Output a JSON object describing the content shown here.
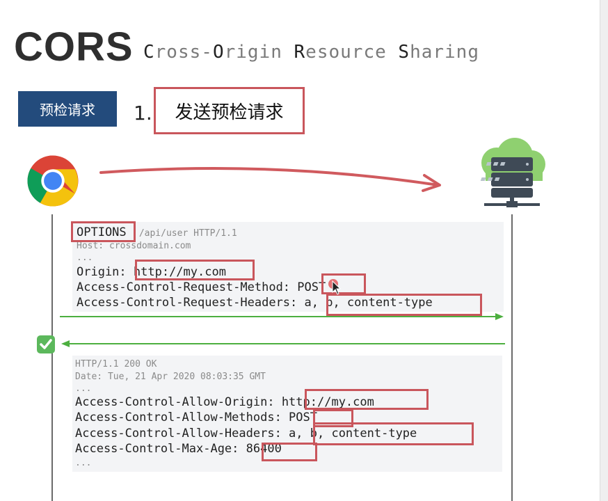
{
  "title": "CORS",
  "subtitle": {
    "c1": "C",
    "r1": "ross-",
    "c2": "O",
    "r2": "rigin ",
    "c3": "R",
    "r3": "esource ",
    "c4": "S",
    "r4": "haring"
  },
  "badge": "预检请求",
  "step": {
    "number": "1.",
    "label": "发送预检请求"
  },
  "request": {
    "method": "OPTIONS",
    "path": " /api/user HTTP/1.1",
    "host": "Host: crossdomain.com",
    "ellipsis": "...",
    "origin_key": "Origin: ",
    "origin_val": "http://my.com",
    "acrm_key": "Access-Control-Request-Method: ",
    "acrm_val": "POST",
    "acrh_key": "Access-Control-Request-Headers: ",
    "acrh_val": "a, b, content-type"
  },
  "response": {
    "status": "HTTP/1.1 200 OK",
    "date": "Date: Tue, 21 Apr 2020 08:03:35 GMT",
    "ellipsis": "...",
    "acao_key": "Access-Control-Allow-Origin: ",
    "acao_val": "http://my.com",
    "acam_key": "Access-Control-Allow-Methods: ",
    "acam_val": "POST",
    "acah_key": "Access-Control-Allow-Headers: ",
    "acah_val": "a, b, content-type",
    "acma_key": "Access-Control-Max-Age: ",
    "acma_val": "86400",
    "ellipsis_end": "..."
  },
  "colors": {
    "highlight": "#c9565c",
    "badge": "#234b7c",
    "arrow_green": "#4caf3f",
    "top_arrow": "#d05a5e"
  },
  "icons": {
    "browser": "chrome-icon",
    "server": "cloud-server-icon",
    "check": "check-mark-icon"
  }
}
